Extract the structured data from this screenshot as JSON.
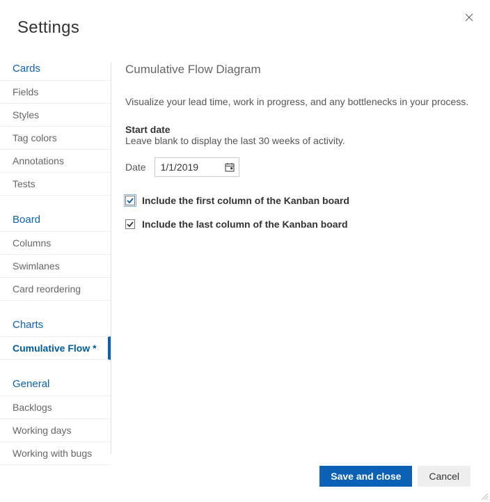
{
  "window": {
    "title": "Settings"
  },
  "sidebar": {
    "sections": [
      {
        "header": "Cards",
        "items": [
          {
            "label": "Fields"
          },
          {
            "label": "Styles"
          },
          {
            "label": "Tag colors"
          },
          {
            "label": "Annotations"
          },
          {
            "label": "Tests"
          }
        ]
      },
      {
        "header": "Board",
        "items": [
          {
            "label": "Columns"
          },
          {
            "label": "Swimlanes"
          },
          {
            "label": "Card reordering"
          }
        ]
      },
      {
        "header": "Charts",
        "items": [
          {
            "label": "Cumulative Flow *",
            "active": true
          }
        ]
      },
      {
        "header": "General",
        "items": [
          {
            "label": "Backlogs"
          },
          {
            "label": "Working days"
          },
          {
            "label": "Working with bugs"
          }
        ]
      }
    ]
  },
  "panel": {
    "title": "Cumulative Flow Diagram",
    "description": "Visualize your lead time, work in progress, and any bottlenecks in your process.",
    "start_date_label": "Start date",
    "start_date_hint": "Leave blank to display the last 30 weeks of activity.",
    "date_label": "Date",
    "date_value": "1/1/2019",
    "checkbox_first_label": "Include the first column of the Kanban board",
    "checkbox_first_checked": true,
    "checkbox_last_label": "Include the last column of the Kanban board",
    "checkbox_last_checked": true
  },
  "footer": {
    "save_label": "Save and close",
    "cancel_label": "Cancel"
  }
}
